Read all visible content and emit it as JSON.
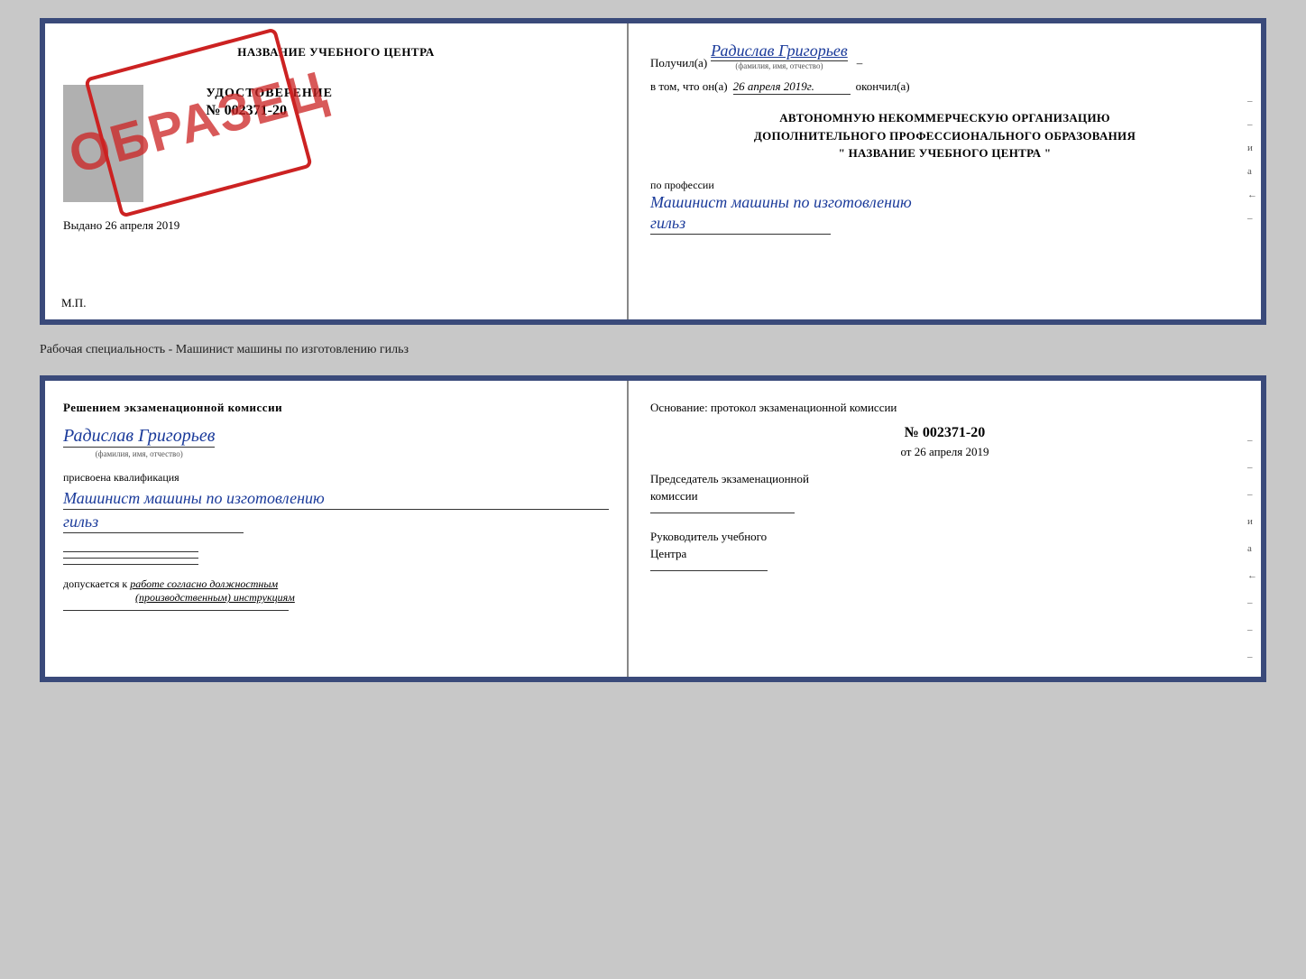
{
  "topDoc": {
    "leftSide": {
      "schoolName": "НАЗВАНИЕ УЧЕБНОГО ЦЕНТРА",
      "udostoverenie": {
        "label": "УДОСТОВЕРЕНИЕ",
        "number": "№ 002371-20"
      },
      "vydano": "Выдано",
      "vydanoDate": "26 апреля 2019",
      "mp": "М.П."
    },
    "stamp": "ОБРАЗЕЦ",
    "rightSide": {
      "poluchilPrefix": "Получил(а)",
      "personName": "Радислав Григорьев",
      "fioCaption": "(фамилия, имя, отчество)",
      "dash": "–",
      "vtomPrefix": "в том, что он(а)",
      "date": "26 апреля 2019г.",
      "okoncilSuffix": "окончил(а)",
      "orgLine1": "АВТОНОМНУЮ НЕКОММЕРЧЕСКУЮ ОРГАНИЗАЦИЮ",
      "orgLine2": "ДОПОЛНИТЕЛЬНОГО ПРОФЕССИОНАЛЬНОГО ОБРАЗОВАНИЯ",
      "orgName": "\"  НАЗВАНИЕ УЧЕБНОГО ЦЕНТРА  \"",
      "poProfilessiPrefix": "по профессии",
      "profession1": "Машинист машины по изготовлению",
      "profession2": "гильз",
      "sideMarks": [
        "–",
        "–",
        "и",
        "а",
        "←",
        "–"
      ]
    }
  },
  "subtitleLine": "Рабочая специальность - Машинист машины по изготовлению гильз",
  "bottomDoc": {
    "leftSide": {
      "resheniem": "Решением  экзаменационной  комиссии",
      "personName": "Радислав Григорьев",
      "fioCaption": "(фамилия, имя, отчество)",
      "prisvoena": "присвоена квалификация",
      "kval1": "Машинист машины по изготовлению",
      "kval2": "гильз",
      "dopuskaetsya": "допускается к",
      "dopuskItalic": "работе согласно должностным",
      "dopuskItalic2": "(производственным) инструкциям"
    },
    "rightSide": {
      "osnovanie": "Основание: протокол экзаменационной комиссии",
      "number": "№  002371-20",
      "otPrefix": "от",
      "date": "26 апреля 2019",
      "predsedatel1": "Председатель экзаменационной",
      "predsedatel2": "комиссии",
      "rukovoditel1": "Руководитель учебного",
      "rukovoditel2": "Центра",
      "sideMarks": [
        "–",
        "–",
        "–",
        "и",
        "а",
        "←",
        "–",
        "–",
        "–"
      ]
    }
  }
}
